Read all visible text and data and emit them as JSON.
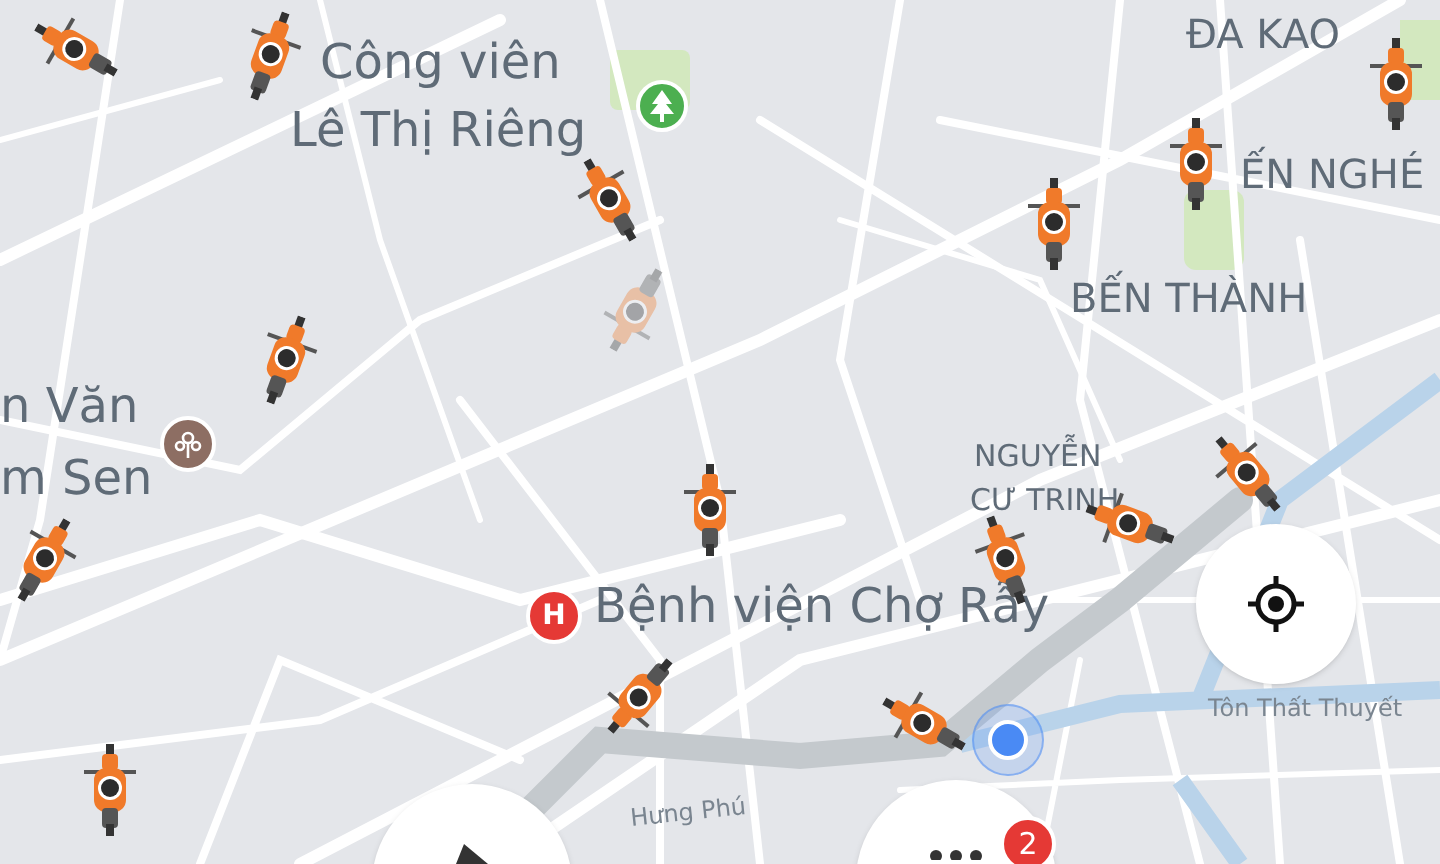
{
  "map": {
    "labels": [
      {
        "kind": "poi",
        "text": "Công viên"
      },
      {
        "kind": "poi",
        "text": "Lê Thị Riêng"
      },
      {
        "kind": "district",
        "text": "ĐA KAO"
      },
      {
        "kind": "district",
        "text": "ẾN NGHÉ"
      },
      {
        "kind": "district",
        "text": "BẾN THÀNH"
      },
      {
        "kind": "poi",
        "text": "n Văn"
      },
      {
        "kind": "poi",
        "text": "m Sen"
      },
      {
        "kind": "area",
        "text": "NGUYỄN"
      },
      {
        "kind": "area",
        "text": "CƯ TRINH"
      },
      {
        "kind": "poi",
        "text": "Bệnh viện Chợ Rẫy"
      },
      {
        "kind": "street",
        "text": "Tôn Thất Thuyết"
      },
      {
        "kind": "street",
        "text": "Hưng Phú"
      }
    ],
    "hospital_marker": "H"
  },
  "notification_badge": "2"
}
